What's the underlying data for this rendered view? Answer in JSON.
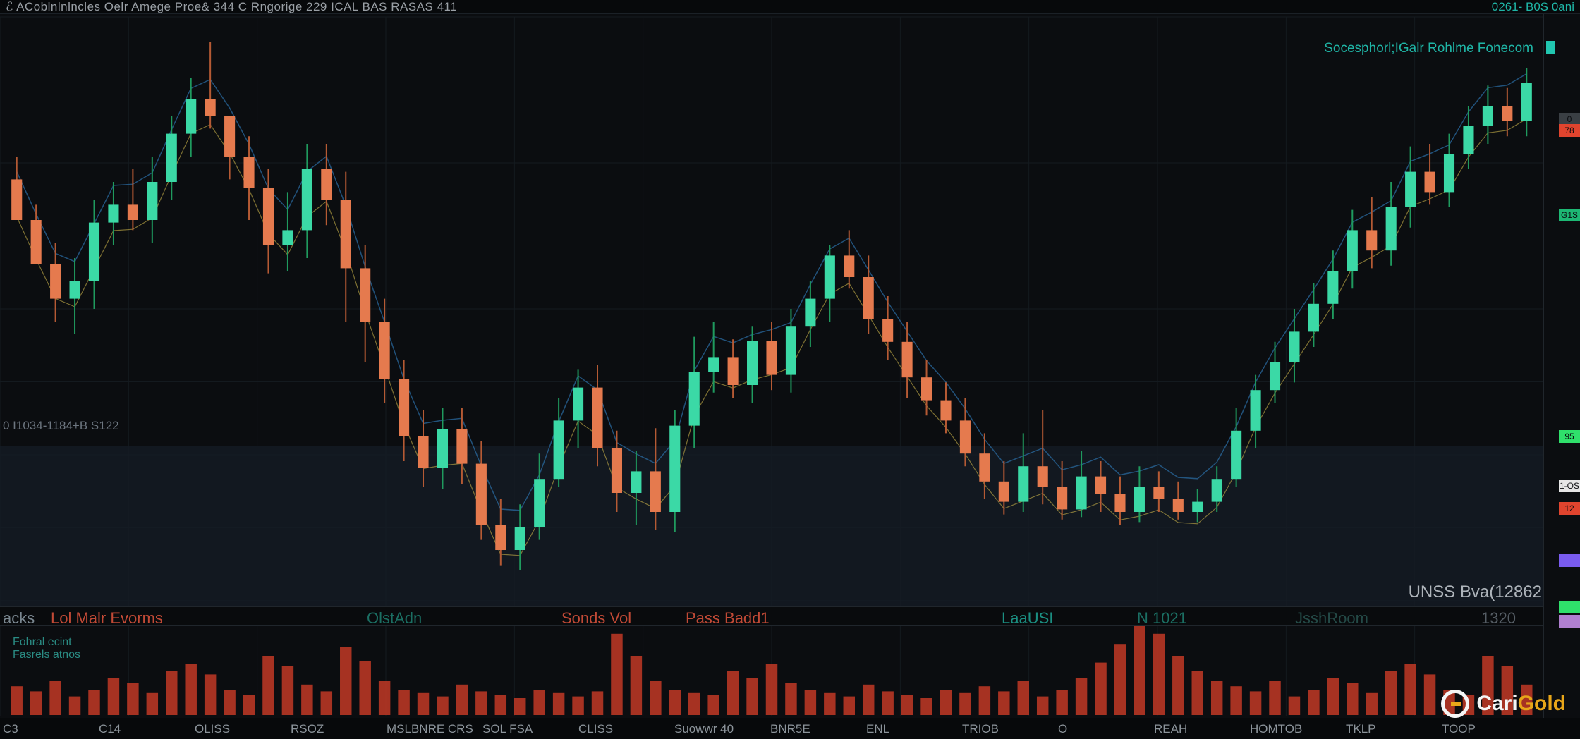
{
  "header": {
    "title": "ℰ ACoblnlnlncles Oelr Amege Proe& 344 C Rngorige 229 ICAL BAS RASAS 411",
    "right_label": "0261- B0S 0ani"
  },
  "main_chart": {
    "symbol_label": "Socesphorl;IGalr Rohlme Fonecom",
    "lower_info": "0 I1034-1184+B S122",
    "pane_label": "UNSS Bva(12862"
  },
  "indicators": [
    {
      "label": "acks",
      "color": "#7a8790"
    },
    {
      "label": "Lol Malr Evorms",
      "color": "#c24a36"
    },
    {
      "label": "OlstAdn",
      "color": "#1b6f63"
    },
    {
      "label": "Sonds Vol",
      "color": "#c24a36"
    },
    {
      "label": "Pass Badd1",
      "color": "#c24a36"
    },
    {
      "label": "LaaUSI",
      "color": "#1b8f82"
    },
    {
      "label": "N 1021",
      "color": "#1b6f63"
    },
    {
      "label": "JsshRoom",
      "color": "#244a47"
    },
    {
      "label": "1320",
      "color": "#555d64"
    }
  ],
  "volume_labels": [
    "Fohral ecint",
    "Fasrels atnos"
  ],
  "x_axis": {
    "ticks": [
      "C3",
      "C14",
      "OLISS",
      "RSOZ",
      "MSLBNRE CRS",
      "SOL FSA",
      "CLISS",
      "Suowwr 40",
      "BNR5E",
      "ENL",
      "TRIOB",
      "O",
      "REAH",
      "HOMTOB",
      "TKLP",
      "TOOP"
    ]
  },
  "price_tags": [
    {
      "label": "0",
      "color": "#3a3f44"
    },
    {
      "label": "78",
      "color": "#e0442e"
    },
    {
      "label": "G1S",
      "color": "#1db874"
    },
    {
      "label": "95",
      "color": "#2fe06b"
    },
    {
      "label": "1-OS",
      "color": "#e6e6e6"
    },
    {
      "label": "12",
      "color": "#e0442e"
    },
    {
      "label": "",
      "color": "#7a5cf0"
    },
    {
      "label": "",
      "color": "#2fe06b"
    },
    {
      "label": "",
      "color": "#b07fd0"
    }
  ],
  "logo": {
    "brand_white": "Cari",
    "brand_gold": "Gold"
  },
  "colors": {
    "up": "#3bd9a6",
    "down": "#e57a4e",
    "accent": "#1fb5a6",
    "volume": "#c23a26",
    "background": "#0b0d10"
  },
  "chart_data": {
    "type": "candlestick",
    "candles": [
      {
        "o": 412,
        "c": 380,
        "h": 430,
        "l": 396
      },
      {
        "o": 380,
        "c": 345,
        "h": 360,
        "l": 392
      },
      {
        "o": 345,
        "c": 318,
        "h": 300,
        "l": 362
      },
      {
        "o": 318,
        "c": 332,
        "h": 290,
        "l": 350
      },
      {
        "o": 332,
        "c": 378,
        "h": 310,
        "l": 396
      },
      {
        "o": 378,
        "c": 392,
        "h": 360,
        "l": 410
      },
      {
        "o": 392,
        "c": 380,
        "h": 372,
        "l": 420
      },
      {
        "o": 380,
        "c": 410,
        "h": 362,
        "l": 430
      },
      {
        "o": 410,
        "c": 448,
        "h": 396,
        "l": 462
      },
      {
        "o": 448,
        "c": 475,
        "h": 430,
        "l": 492
      },
      {
        "o": 475,
        "c": 462,
        "h": 452,
        "l": 520
      },
      {
        "o": 462,
        "c": 430,
        "h": 412,
        "l": 452
      },
      {
        "o": 430,
        "c": 405,
        "h": 380,
        "l": 446
      },
      {
        "o": 405,
        "c": 360,
        "h": 338,
        "l": 420
      },
      {
        "o": 360,
        "c": 372,
        "h": 340,
        "l": 402
      },
      {
        "o": 372,
        "c": 420,
        "h": 350,
        "l": 440
      },
      {
        "o": 420,
        "c": 396,
        "h": 376,
        "l": 440
      },
      {
        "o": 396,
        "c": 342,
        "h": 300,
        "l": 418
      },
      {
        "o": 342,
        "c": 300,
        "h": 268,
        "l": 360
      },
      {
        "o": 300,
        "c": 255,
        "h": 236,
        "l": 318
      },
      {
        "o": 255,
        "c": 210,
        "h": 190,
        "l": 270
      },
      {
        "o": 210,
        "c": 185,
        "h": 170,
        "l": 230
      },
      {
        "o": 185,
        "c": 215,
        "h": 168,
        "l": 232
      },
      {
        "o": 215,
        "c": 188,
        "h": 172,
        "l": 232
      },
      {
        "o": 188,
        "c": 140,
        "h": 128,
        "l": 206
      },
      {
        "o": 140,
        "c": 120,
        "h": 108,
        "l": 160
      },
      {
        "o": 120,
        "c": 138,
        "h": 104,
        "l": 156
      },
      {
        "o": 138,
        "c": 176,
        "h": 128,
        "l": 196
      },
      {
        "o": 176,
        "c": 222,
        "h": 170,
        "l": 240
      },
      {
        "o": 222,
        "c": 248,
        "h": 200,
        "l": 262
      },
      {
        "o": 248,
        "c": 200,
        "h": 186,
        "l": 266
      },
      {
        "o": 200,
        "c": 165,
        "h": 150,
        "l": 214
      },
      {
        "o": 165,
        "c": 182,
        "h": 140,
        "l": 198
      },
      {
        "o": 182,
        "c": 150,
        "h": 136,
        "l": 216
      },
      {
        "o": 150,
        "c": 218,
        "h": 134,
        "l": 230
      },
      {
        "o": 218,
        "c": 260,
        "h": 200,
        "l": 288
      },
      {
        "o": 260,
        "c": 272,
        "h": 244,
        "l": 300
      },
      {
        "o": 272,
        "c": 250,
        "h": 240,
        "l": 286
      },
      {
        "o": 250,
        "c": 285,
        "h": 236,
        "l": 296
      },
      {
        "o": 285,
        "c": 258,
        "h": 246,
        "l": 300
      },
      {
        "o": 258,
        "c": 296,
        "h": 244,
        "l": 310
      },
      {
        "o": 296,
        "c": 318,
        "h": 280,
        "l": 332
      },
      {
        "o": 318,
        "c": 352,
        "h": 300,
        "l": 360
      },
      {
        "o": 352,
        "c": 335,
        "h": 326,
        "l": 372
      },
      {
        "o": 335,
        "c": 302,
        "h": 290,
        "l": 352
      },
      {
        "o": 302,
        "c": 284,
        "h": 270,
        "l": 320
      },
      {
        "o": 284,
        "c": 256,
        "h": 240,
        "l": 300
      },
      {
        "o": 256,
        "c": 238,
        "h": 226,
        "l": 270
      },
      {
        "o": 238,
        "c": 222,
        "h": 212,
        "l": 252
      },
      {
        "o": 222,
        "c": 196,
        "h": 186,
        "l": 240
      },
      {
        "o": 196,
        "c": 174,
        "h": 160,
        "l": 212
      },
      {
        "o": 174,
        "c": 158,
        "h": 148,
        "l": 190
      },
      {
        "o": 158,
        "c": 186,
        "h": 150,
        "l": 212
      },
      {
        "o": 186,
        "c": 170,
        "h": 156,
        "l": 230
      },
      {
        "o": 170,
        "c": 152,
        "h": 144,
        "l": 190
      },
      {
        "o": 152,
        "c": 178,
        "h": 146,
        "l": 198
      },
      {
        "o": 178,
        "c": 164,
        "h": 150,
        "l": 190
      },
      {
        "o": 164,
        "c": 150,
        "h": 140,
        "l": 178
      },
      {
        "o": 150,
        "c": 170,
        "h": 142,
        "l": 186
      },
      {
        "o": 170,
        "c": 160,
        "h": 150,
        "l": 182
      },
      {
        "o": 160,
        "c": 150,
        "h": 144,
        "l": 174
      },
      {
        "o": 150,
        "c": 158,
        "h": 142,
        "l": 168
      },
      {
        "o": 158,
        "c": 176,
        "h": 150,
        "l": 186
      },
      {
        "o": 176,
        "c": 214,
        "h": 170,
        "l": 232
      },
      {
        "o": 214,
        "c": 246,
        "h": 200,
        "l": 258
      },
      {
        "o": 246,
        "c": 268,
        "h": 236,
        "l": 284
      },
      {
        "o": 268,
        "c": 292,
        "h": 252,
        "l": 310
      },
      {
        "o": 292,
        "c": 314,
        "h": 280,
        "l": 330
      },
      {
        "o": 314,
        "c": 340,
        "h": 302,
        "l": 356
      },
      {
        "o": 340,
        "c": 372,
        "h": 326,
        "l": 388
      },
      {
        "o": 372,
        "c": 356,
        "h": 342,
        "l": 398
      },
      {
        "o": 356,
        "c": 390,
        "h": 344,
        "l": 410
      },
      {
        "o": 390,
        "c": 418,
        "h": 374,
        "l": 438
      },
      {
        "o": 418,
        "c": 402,
        "h": 392,
        "l": 440
      },
      {
        "o": 402,
        "c": 432,
        "h": 390,
        "l": 448
      },
      {
        "o": 432,
        "c": 454,
        "h": 420,
        "l": 470
      },
      {
        "o": 454,
        "c": 470,
        "h": 440,
        "l": 486
      },
      {
        "o": 470,
        "c": 458,
        "h": 446,
        "l": 484
      },
      {
        "o": 458,
        "c": 488,
        "h": 446,
        "l": 500
      }
    ],
    "volume": [
      34,
      28,
      40,
      22,
      30,
      44,
      38,
      26,
      52,
      60,
      48,
      30,
      24,
      70,
      58,
      36,
      28,
      80,
      64,
      40,
      30,
      26,
      22,
      36,
      28,
      24,
      20,
      30,
      26,
      22,
      28,
      96,
      70,
      40,
      30,
      26,
      24,
      52,
      44,
      60,
      38,
      30,
      26,
      22,
      36,
      28,
      24,
      20,
      30,
      26,
      34,
      28,
      40,
      22,
      30,
      44,
      62,
      84,
      110,
      96,
      70,
      52,
      40,
      34,
      28,
      40,
      22,
      30,
      44,
      38,
      26,
      52,
      60,
      48,
      30,
      24,
      70,
      58,
      36
    ]
  }
}
